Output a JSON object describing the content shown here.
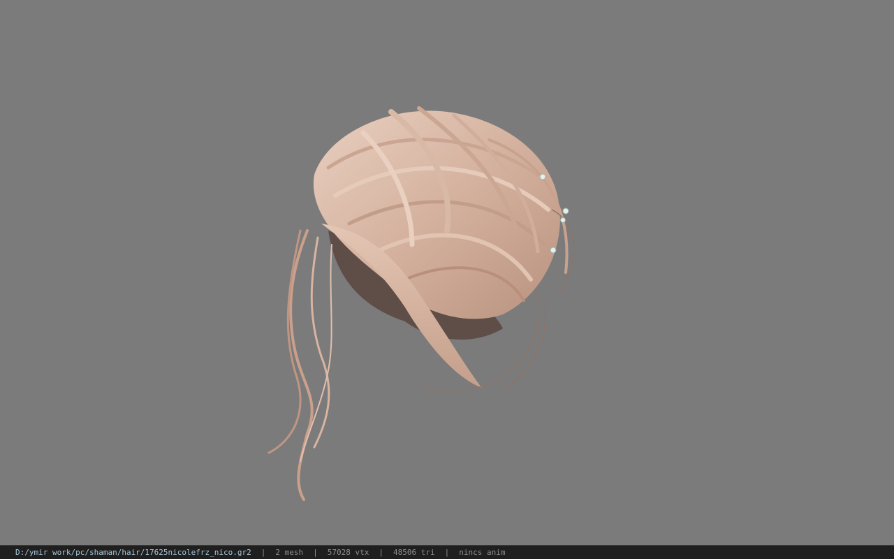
{
  "viewer": {
    "background_color": "#7b7b7b",
    "model": {
      "subject": "hair mesh (updo bun with pearl pins)",
      "hair_color": "#d9b9a6",
      "shadow_color": "#6b5a52",
      "accessory_color": "#e6efe9"
    }
  },
  "statusbar": {
    "file_path": "D:/ymir work/pc/shaman/hair/17625nicolefrz_nico.gr2",
    "separator": "|",
    "mesh_count": "2 mesh",
    "vertex_count": "57028 vtx",
    "triangle_count": "48506 tri",
    "anim_status": "nincs anim"
  }
}
